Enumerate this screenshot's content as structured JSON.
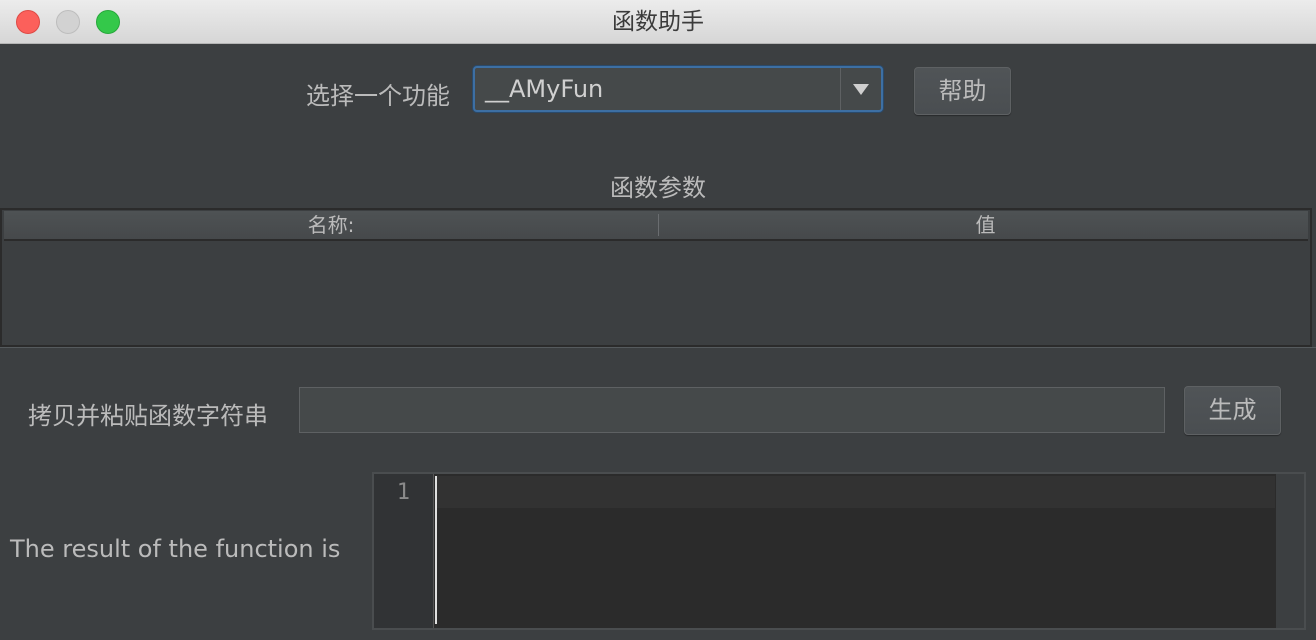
{
  "window": {
    "title": "函数助手"
  },
  "selector": {
    "label": "选择一个功能",
    "selected": "__AMyFun",
    "help_button": "帮助"
  },
  "params": {
    "section_title": "函数参数",
    "columns": [
      "名称:",
      "值"
    ],
    "rows": []
  },
  "paste": {
    "label": "拷贝并粘贴函数字符串",
    "value": "",
    "generate_button": "生成"
  },
  "result": {
    "label": "The result of the function is",
    "line_numbers": [
      "1"
    ],
    "content": ""
  },
  "icons": {
    "combo_arrow": "chevron-down-icon"
  }
}
